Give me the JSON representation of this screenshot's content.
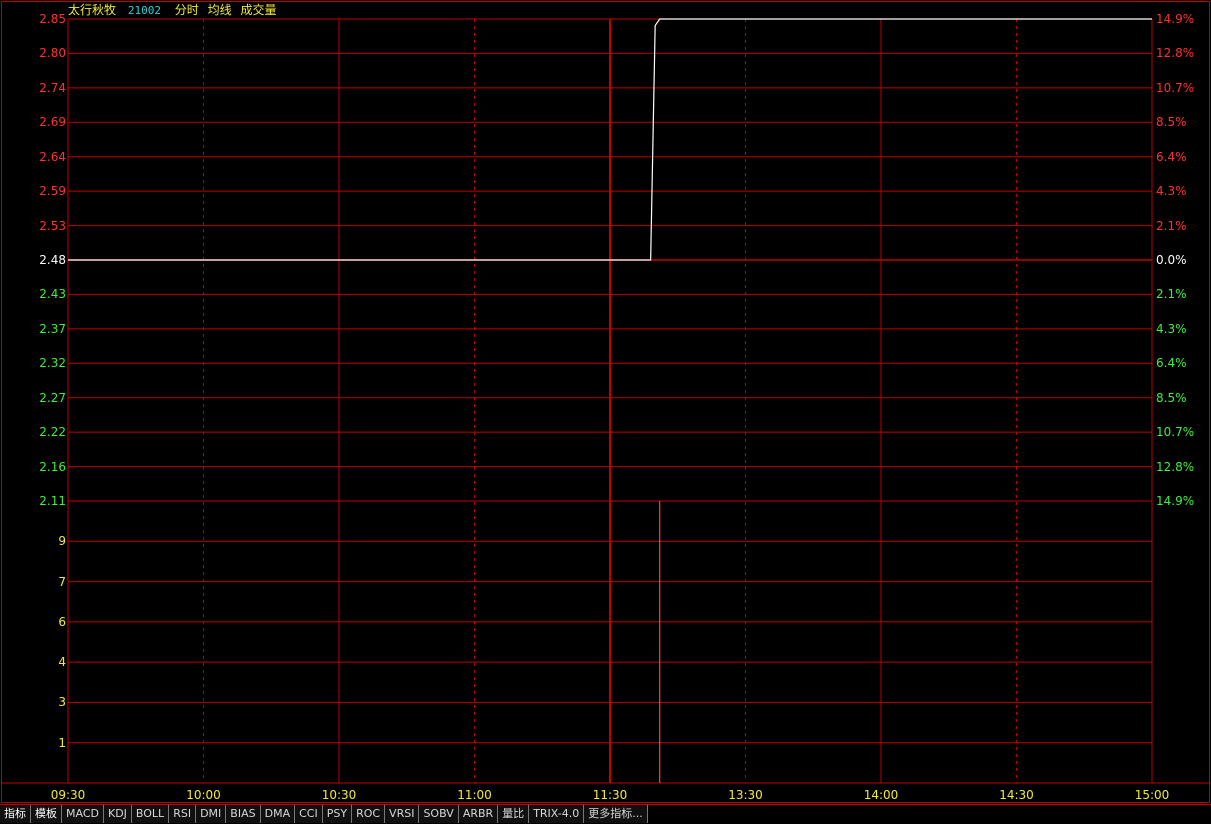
{
  "header": {
    "stock_name": "太行秋牧",
    "stock_code": "21002",
    "labels": [
      "分时",
      "均线",
      "成交量"
    ]
  },
  "colors": {
    "background": "#000000",
    "grid": "#c00000",
    "up": "#ff3030",
    "down": "#3cf03c",
    "neutral": "#ffffff",
    "volume_axis": "#f2ec2c",
    "price_line": "#ffffff",
    "volume_bar": "#ff4040"
  },
  "chart_data": {
    "type": "line",
    "price_axis": {
      "prev_close": 2.48,
      "ylim": [
        2.11,
        2.85
      ],
      "ticks": [
        "2.85",
        "2.80",
        "2.74",
        "2.69",
        "2.64",
        "2.59",
        "2.53",
        "2.48",
        "2.43",
        "2.37",
        "2.32",
        "2.27",
        "2.22",
        "2.16",
        "2.11"
      ],
      "pct_ticks": [
        "14.9%",
        "12.8%",
        "10.7%",
        "8.5%",
        "6.4%",
        "4.3%",
        "2.1%",
        "0.0%",
        "2.1%",
        "4.3%",
        "6.4%",
        "8.5%",
        "10.7%",
        "12.8%",
        "14.9%"
      ]
    },
    "volume_axis": {
      "ticks": [
        "9",
        "7",
        "6",
        "4",
        "3",
        "1"
      ]
    },
    "time_ticks": [
      "09:30",
      "10:00",
      "10:30",
      "11:00",
      "11:30",
      "13:30",
      "14:00",
      "14:30",
      "15:00"
    ],
    "price_series": [
      {
        "t": 0,
        "v": 2.48
      },
      {
        "t": 129,
        "v": 2.48
      },
      {
        "t": 130,
        "v": 2.84
      },
      {
        "t": 131,
        "v": 2.85
      },
      {
        "t": 240,
        "v": 2.85
      }
    ],
    "volume_bars": [
      {
        "t": 131,
        "v": 10
      }
    ]
  },
  "toolbar": {
    "items": [
      "指标",
      "模板",
      "MACD",
      "KDJ",
      "BOLL",
      "RSI",
      "DMI",
      "BIAS",
      "DMA",
      "CCI",
      "PSY",
      "ROC",
      "VRSI",
      "SOBV",
      "ARBR",
      "量比",
      "TRIX-4.0",
      "更多指标..."
    ]
  }
}
